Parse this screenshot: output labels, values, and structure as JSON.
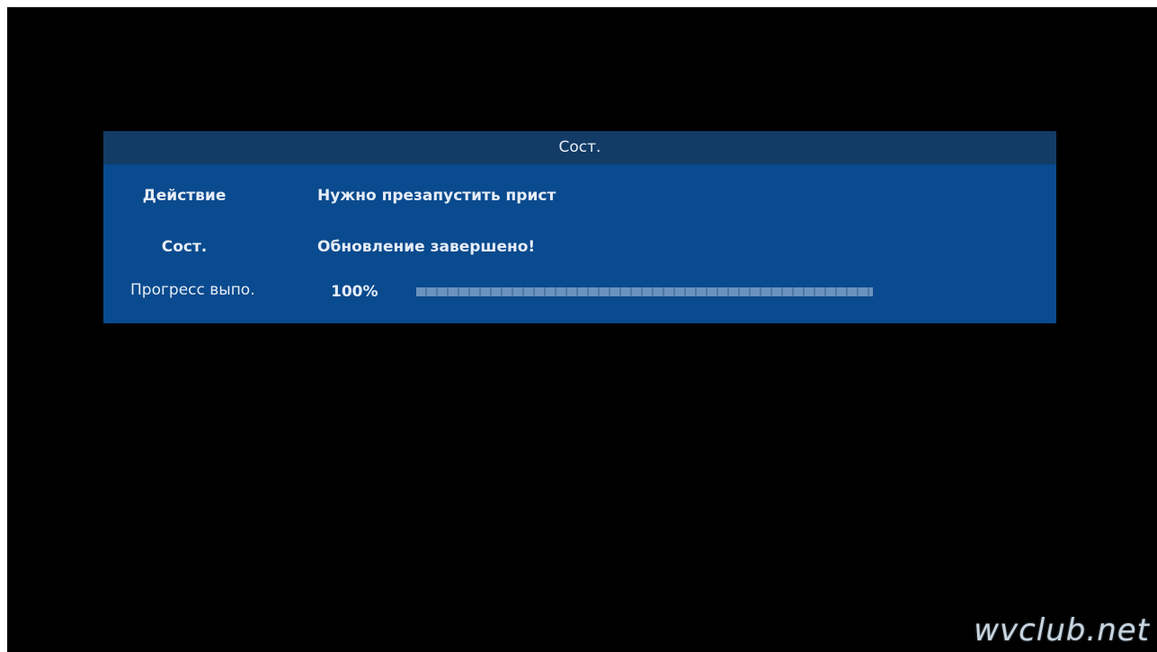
{
  "dialog": {
    "title": "Сост.",
    "rows": {
      "action": {
        "label": "Действие",
        "value": "Нужно презапустить прист"
      },
      "state": {
        "label": "Сост.",
        "value": "Обновление завершено!"
      },
      "progress": {
        "label": "Прогресс выпо.",
        "percent_text": "100%",
        "fraction": 1.0
      }
    }
  },
  "watermark": "wvclub.net",
  "colors": {
    "background": "#000000",
    "dialog_body": "#0a4a8e",
    "dialog_header": "#123b66",
    "progress_fill": "#6b93bf"
  }
}
